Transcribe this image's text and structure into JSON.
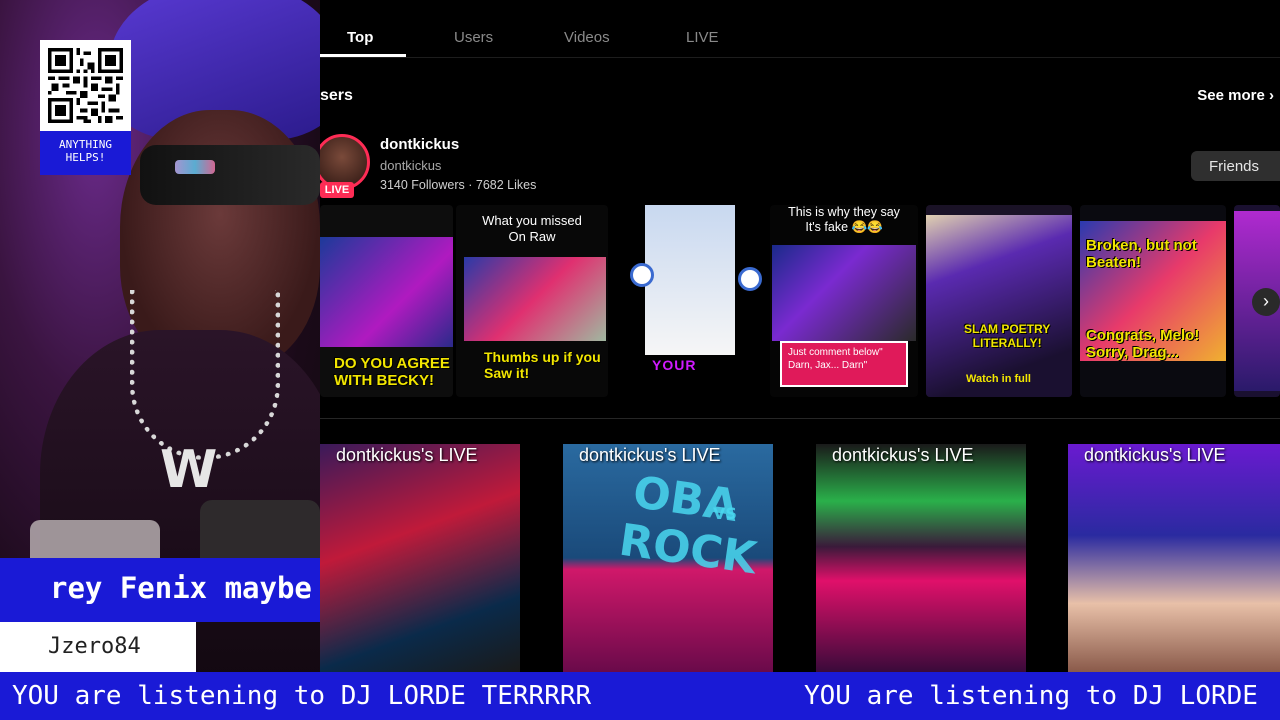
{
  "donation": {
    "qr_icon": "qr-code-icon",
    "text": "ANYTHING HELPS!"
  },
  "chat": {
    "message": "rey Fenix maybe",
    "username": "Jzero84"
  },
  "ticker": {
    "text_1": "YOU are listening to DJ LORDE TERRRRR",
    "text_2": "YOU are listening to DJ LORDE"
  },
  "tabs": [
    {
      "label": "Top",
      "active": true
    },
    {
      "label": "Users",
      "active": false
    },
    {
      "label": "Videos",
      "active": false
    },
    {
      "label": "LIVE",
      "active": false
    }
  ],
  "users_section": {
    "title": "sers",
    "see_more": "See more",
    "user": {
      "name": "dontkickus",
      "handle": "dontkickus",
      "live_badge": "LIVE",
      "stats": "3140 Followers  ·  7682 Likes",
      "button": "Friends"
    }
  },
  "videos": [
    {
      "captions": [
        "DO YOU AGREE",
        "WITH BECKY!"
      ]
    },
    {
      "top": [
        "What you missed",
        "On Raw"
      ],
      "captions": [
        "Thumbs up if you",
        "Saw it!"
      ]
    },
    {
      "captions": [
        "YOUR"
      ]
    },
    {
      "top": [
        "This is why they say",
        "It's fake 😂😂"
      ],
      "comment": [
        "Just comment  below\"",
        "Darn, Jax... Darn\""
      ]
    },
    {
      "captions": [
        "SLAM POETRY",
        "LITERALLY!"
      ],
      "footer": "Watch in full"
    },
    {
      "captions": [
        "Broken, but not",
        "Beaten!"
      ],
      "captions_2": [
        "Congrats, Melo!",
        "Sorry, Drag..."
      ]
    }
  ],
  "live_cards": [
    {
      "label": "dontkickus's LIVE"
    },
    {
      "label": "dontkickus's LIVE",
      "overlay": [
        "OBA",
        "VS",
        "ROCK"
      ]
    },
    {
      "label": "dontkickus's LIVE"
    },
    {
      "label": "dontkickus's LIVE"
    }
  ],
  "colors": {
    "overlay_blue": "#1a1ad6",
    "live_red": "#fe2c55",
    "caption_yellow": "#f2e600"
  }
}
